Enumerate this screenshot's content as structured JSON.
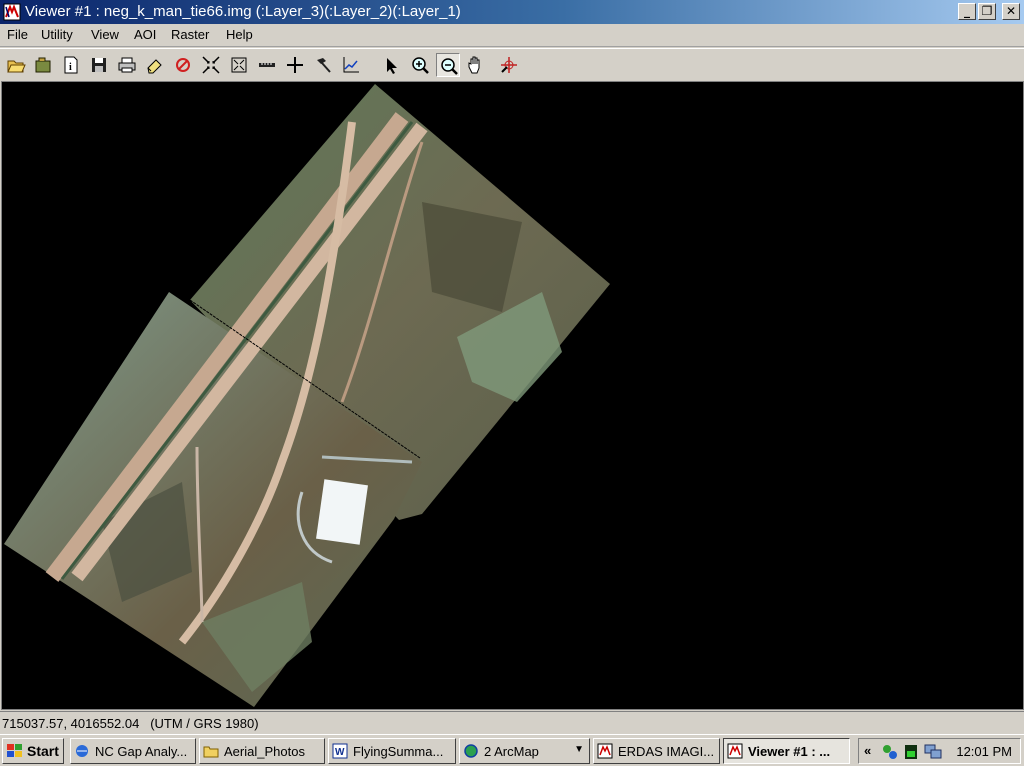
{
  "window": {
    "title": "Viewer #1 : neg_k_man_tie66.img (:Layer_3)(:Layer_2)(:Layer_1)",
    "controls": [
      "_",
      "❐",
      "✕"
    ]
  },
  "menu": [
    "File",
    "Utility",
    "View",
    "AOI",
    "Raster",
    "Help"
  ],
  "toolbar": [
    "open-icon",
    "layer-icon",
    "info-icon",
    "save-icon",
    "print-icon",
    "eraser-icon",
    "clear-icon",
    "zoom-in-extents-icon",
    "fit-icon",
    "measure-icon",
    "crosshair-icon",
    "hammer-icon",
    "profile-icon",
    "pointer-icon",
    "zoom-in-icon",
    "zoom-out-icon",
    "pan-icon",
    "inquire-icon"
  ],
  "status": {
    "coordinates": "715037.57, 4016552.04",
    "projection": "(UTM / GRS 1980)"
  },
  "taskbar": {
    "start": "Start",
    "tasks": [
      {
        "label": "NC Gap Analy...",
        "icon": "browser-icon"
      },
      {
        "label": "Aerial_Photos",
        "icon": "folder-icon"
      },
      {
        "label": "FlyingSumma...",
        "icon": "word-icon"
      },
      {
        "label": "2 ArcMap",
        "icon": "globe-icon"
      },
      {
        "label": "ERDAS IMAGI...",
        "icon": "erdas-icon"
      },
      {
        "label": "Viewer #1 : ...",
        "icon": "erdas-icon"
      }
    ],
    "clock": "12:01 PM",
    "tray_toggle": "«"
  }
}
